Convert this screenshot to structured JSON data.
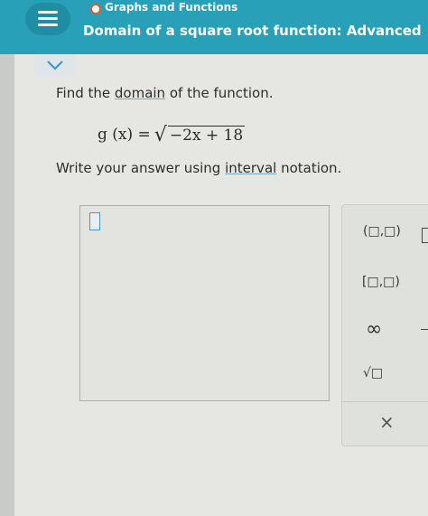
{
  "header": {
    "topic": "Graphs and Functions",
    "title": "Domain of a square root function: Advanced",
    "accent_color": "#27a0b8",
    "status_color": "#e5572f",
    "menu_icon": "hamburger-menu-icon"
  },
  "collapse_icon": "chevron-down-icon",
  "question": {
    "prompt_before": "Find the ",
    "prompt_link": "domain",
    "prompt_after": " of the function.",
    "function_name": "g (x) = ",
    "radicand": "−2x + 18",
    "instruction_before": "Write your answer using ",
    "instruction_link": "interval",
    "instruction_after": " notation."
  },
  "answer": {
    "value": ""
  },
  "keypad": {
    "open_interval": "(□,□)",
    "half_open_interval": "[□,□)",
    "infinity": "∞",
    "sqrt": "√□",
    "clear": "×"
  }
}
